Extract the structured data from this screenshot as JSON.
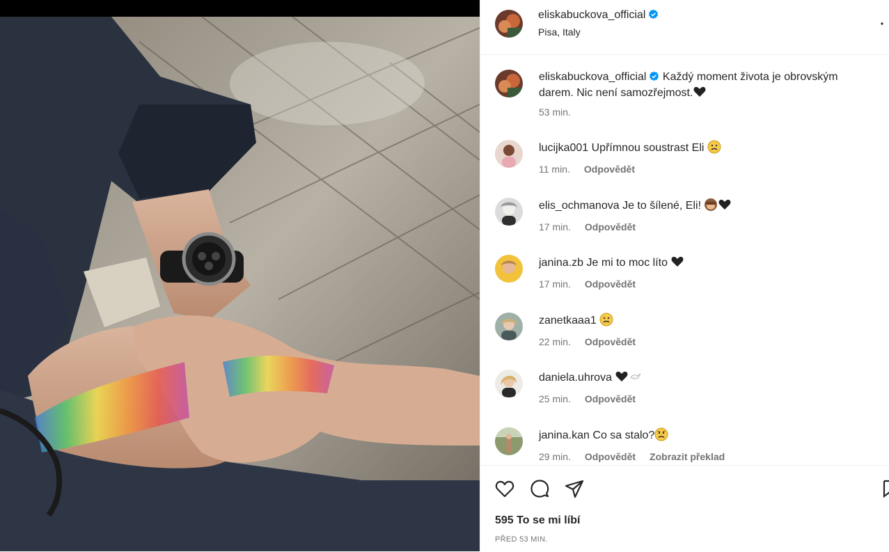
{
  "post": {
    "username": "eliskabuckova_official",
    "location": "Pisa, Italy",
    "caption": "Každý moment života je obrovským darem. Nic není samozřejmost.",
    "caption_emoji": "black-heart",
    "caption_time": "53 min."
  },
  "comments": [
    {
      "user": "lucijka001",
      "text": "Upřímnou soustrast Eli",
      "emoji": "sad-face",
      "time": "11 min.",
      "reply": "Odpovědět"
    },
    {
      "user": "elis_ochmanova",
      "text": "Je to šílené, Eli!",
      "emoji": "see-no-evil-monkey + black-heart",
      "time": "17 min.",
      "reply": "Odpovědět"
    },
    {
      "user": "janina.zb",
      "text": "Je mi to moc líto",
      "emoji": "black-heart",
      "time": "17 min.",
      "reply": "Odpovědět"
    },
    {
      "user": "zanetkaaa1",
      "text": "",
      "emoji": "sad-face",
      "time": "22 min.",
      "reply": "Odpovědět"
    },
    {
      "user": "daniela.uhrova",
      "text": "",
      "emoji": "black-heart + dove",
      "time": "25 min.",
      "reply": "Odpovědět"
    },
    {
      "user": "janina.kan",
      "text": "Co sa stalo?",
      "emoji": "worried-face",
      "time": "29 min.",
      "reply": "Odpovědět",
      "translate": "Zobrazit překlad"
    }
  ],
  "footer": {
    "likes": "595 To se mi líbí",
    "posted": "PŘED 53 MIN."
  },
  "colors": {
    "text": "#262626",
    "muted": "#737373",
    "verified": "#0095f6",
    "divider": "#efefef"
  },
  "icons": [
    "verified-badge-icon",
    "more-options-icon",
    "like-heart-icon",
    "comment-icon",
    "share-icon",
    "save-bookmark-icon"
  ]
}
